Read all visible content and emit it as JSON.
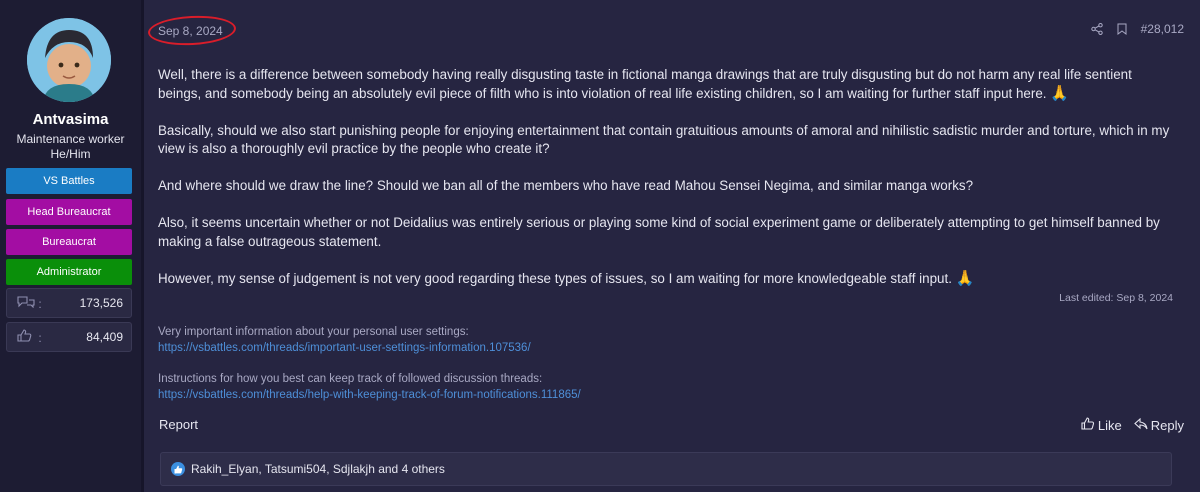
{
  "user": {
    "name": "Antvasima",
    "title_line1": "Maintenance worker",
    "title_line2": "He/Him",
    "banners": [
      {
        "label": "VS Battles",
        "color": "#1a7cc4"
      },
      {
        "label": "Head Bureaucrat",
        "color": "#a30da3"
      },
      {
        "label": "Bureaucrat",
        "color": "#a30da3"
      },
      {
        "label": "Administrator",
        "color": "#0a8f0a"
      }
    ],
    "messages": "173,526",
    "reactions": "84,409"
  },
  "post": {
    "date": "Sep 8, 2024",
    "post_number": "#28,012",
    "paragraphs": [
      "Well, there is a difference between somebody having really disgusting taste in fictional manga drawings that are truly disgusting but do not harm any real life sentient beings, and somebody being an absolutely evil piece of filth who is into violation of real life existing children, so I am waiting for further staff input here.",
      "Basically, should we also start punishing people for enjoying entertainment that contain gratuitious amounts of amoral and nihilistic sadistic murder and torture, which in my view is also a thoroughly evil practice by the people who create it?",
      "And where should we draw the line? Should we ban all of the members who have read Mahou Sensei Negima, and similar manga works?",
      "Also, it seems uncertain whether or not Deidalius was entirely serious or playing some kind of social experiment game or deliberately attempting to get himself banned by making a false outrageous statement.",
      "However, my sense of judgement is not very good regarding these types of issues, so I am waiting for more knowledgeable staff input."
    ],
    "emoji": "🙏",
    "last_edited": "Last edited: Sep 8, 2024"
  },
  "signature": {
    "line1": "Very important information about your personal user settings:",
    "link1": "https://vsbattles.com/threads/important-user-settings-information.107536/",
    "line2": "Instructions for how you best can keep track of followed discussion threads:",
    "link2": "https://vsbattles.com/threads/help-with-keeping-track-of-forum-notifications.111865/"
  },
  "footer": {
    "report": "Report",
    "like": "Like",
    "reply": "Reply",
    "reactions_text": "Rakih_Elyan, Tatsumi504, Sdjlakjh and 4 others"
  }
}
